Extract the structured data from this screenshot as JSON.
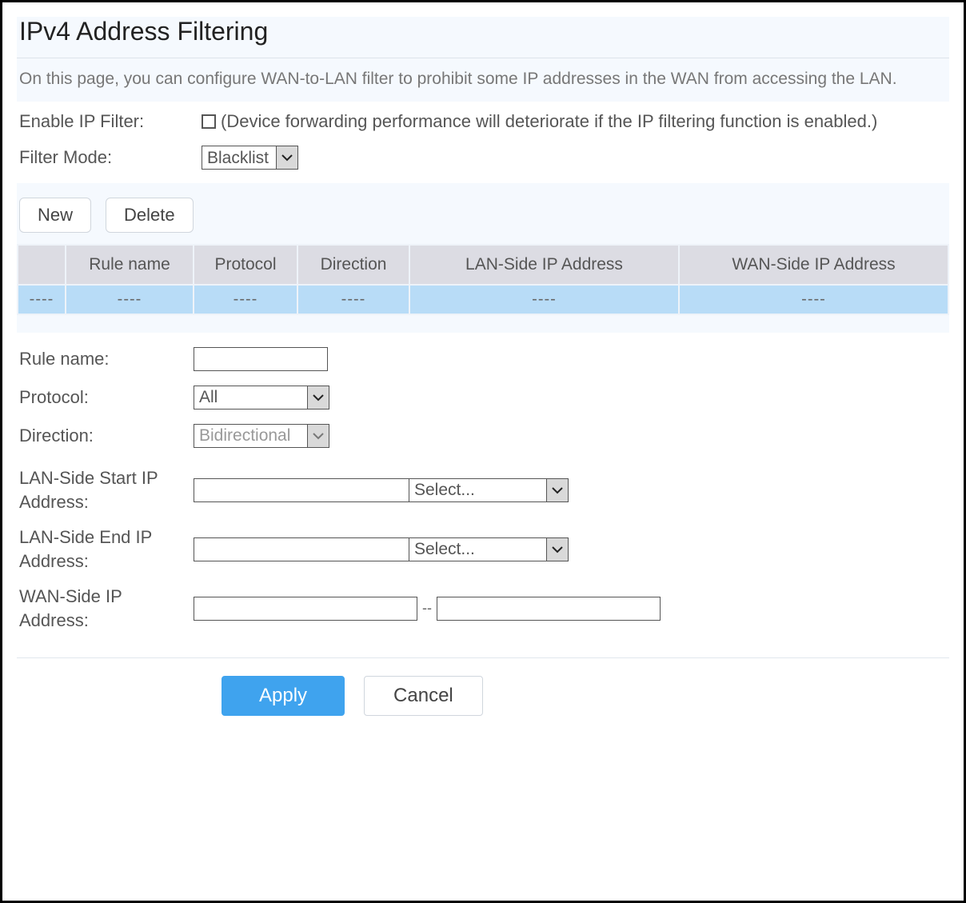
{
  "title": "IPv4 Address Filtering",
  "description": "On this page, you can configure WAN-to-LAN filter to prohibit some IP addresses in the WAN from accessing the LAN.",
  "config": {
    "enable_label": "Enable IP Filter:",
    "enable_note": "(Device forwarding performance will deteriorate if the IP filtering function is enabled.)",
    "enable_checked": false,
    "filter_mode_label": "Filter Mode:",
    "filter_mode_value": "Blacklist"
  },
  "buttons": {
    "new": "New",
    "delete": "Delete",
    "apply": "Apply",
    "cancel": "Cancel"
  },
  "table": {
    "headers": {
      "rule": "Rule name",
      "protocol": "Protocol",
      "direction": "Direction",
      "lan": "LAN-Side IP Address",
      "wan": "WAN-Side IP Address"
    },
    "empty_cell": "----"
  },
  "form": {
    "rule_name_label": "Rule name:",
    "rule_name_value": "",
    "protocol_label": "Protocol:",
    "protocol_value": "All",
    "direction_label": "Direction:",
    "direction_value": "Bidirectional",
    "lan_start_label": "LAN-Side Start IP Address:",
    "lan_start_value": "",
    "lan_start_select": "Select...",
    "lan_end_label": "LAN-Side End IP Address:",
    "lan_end_value": "",
    "lan_end_select": "Select...",
    "wan_label": "WAN-Side IP Address:",
    "wan_start_value": "",
    "wan_dash": "--",
    "wan_end_value": ""
  }
}
